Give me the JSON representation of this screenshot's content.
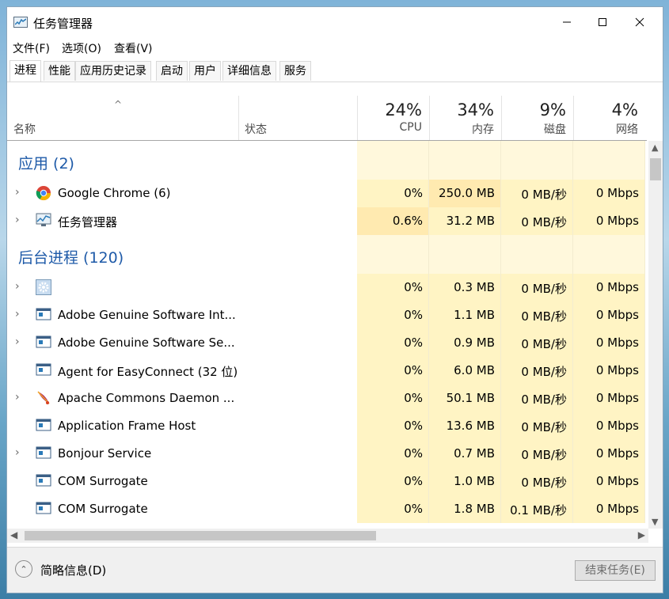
{
  "window": {
    "title": "任务管理器"
  },
  "menu": [
    "文件(F)",
    "选项(O)",
    "查看(V)"
  ],
  "tabs": [
    "进程",
    "性能",
    "应用历史记录",
    "启动",
    "用户",
    "详细信息",
    "服务"
  ],
  "header": {
    "sort_arrow": "^",
    "name_label": "名称",
    "status_label": "状态",
    "metrics": [
      {
        "pct": "24%",
        "label": "CPU"
      },
      {
        "pct": "34%",
        "label": "内存"
      },
      {
        "pct": "9%",
        "label": "磁盘"
      },
      {
        "pct": "4%",
        "label": "网络"
      }
    ]
  },
  "groups": [
    {
      "title": "应用 (2)"
    },
    {
      "title": "后台进程 (120)"
    }
  ],
  "rows": [
    {
      "kind": "group",
      "group": 0
    },
    {
      "kind": "proc",
      "name": "Google Chrome (6)",
      "icon": "chrome-icon",
      "expandable": true,
      "cpu": "0%",
      "mem": "250.0 MB",
      "disk": "0 MB/秒",
      "net": "0 Mbps",
      "cpu_heat": 1
    },
    {
      "kind": "proc",
      "name": "任务管理器",
      "icon": "task-manager-icon",
      "expandable": true,
      "cpu": "0.6%",
      "mem": "31.2 MB",
      "disk": "0 MB/秒",
      "net": "0 Mbps",
      "cpu_heat": 2
    },
    {
      "kind": "group",
      "group": 1
    },
    {
      "kind": "proc",
      "name": "",
      "icon": "gear-icon",
      "expandable": true,
      "cpu": "0%",
      "mem": "0.3 MB",
      "disk": "0 MB/秒",
      "net": "0 Mbps",
      "cpu_heat": 1
    },
    {
      "kind": "proc",
      "name": "Adobe Genuine Software Int...",
      "icon": "service-app-icon",
      "expandable": true,
      "cpu": "0%",
      "mem": "1.1 MB",
      "disk": "0 MB/秒",
      "net": "0 Mbps",
      "cpu_heat": 1
    },
    {
      "kind": "proc",
      "name": "Adobe Genuine Software Se...",
      "icon": "service-app-icon",
      "expandable": true,
      "cpu": "0%",
      "mem": "0.9 MB",
      "disk": "0 MB/秒",
      "net": "0 Mbps",
      "cpu_heat": 1
    },
    {
      "kind": "proc",
      "name": "Agent for EasyConnect (32 位)",
      "icon": "service-app-icon",
      "expandable": false,
      "cpu": "0%",
      "mem": "6.0 MB",
      "disk": "0 MB/秒",
      "net": "0 Mbps",
      "cpu_heat": 1
    },
    {
      "kind": "proc",
      "name": "Apache Commons Daemon ...",
      "icon": "feather-icon",
      "expandable": true,
      "cpu": "0%",
      "mem": "50.1 MB",
      "disk": "0 MB/秒",
      "net": "0 Mbps",
      "cpu_heat": 1
    },
    {
      "kind": "proc",
      "name": "Application Frame Host",
      "icon": "service-app-icon",
      "expandable": false,
      "cpu": "0%",
      "mem": "13.6 MB",
      "disk": "0 MB/秒",
      "net": "0 Mbps",
      "cpu_heat": 1
    },
    {
      "kind": "proc",
      "name": "Bonjour Service",
      "icon": "service-app-icon",
      "expandable": true,
      "cpu": "0%",
      "mem": "0.7 MB",
      "disk": "0 MB/秒",
      "net": "0 Mbps",
      "cpu_heat": 1
    },
    {
      "kind": "proc",
      "name": "COM Surrogate",
      "icon": "service-app-icon",
      "expandable": false,
      "cpu": "0%",
      "mem": "1.0 MB",
      "disk": "0 MB/秒",
      "net": "0 Mbps",
      "cpu_heat": 1
    },
    {
      "kind": "proc",
      "name": "COM Surrogate",
      "icon": "service-app-icon",
      "expandable": false,
      "cpu": "0%",
      "mem": "1.8 MB",
      "disk": "0.1 MB/秒",
      "net": "0 Mbps",
      "cpu_heat": 1
    }
  ],
  "footer": {
    "fewer_details": "简略信息(D)",
    "end_task": "结束任务(E)"
  },
  "colors": {
    "heat_light": "#fff4c4",
    "heat_mid": "#ffeab0",
    "group_bg_col": "#fff8dc",
    "group_title": "#1e5aa8"
  }
}
